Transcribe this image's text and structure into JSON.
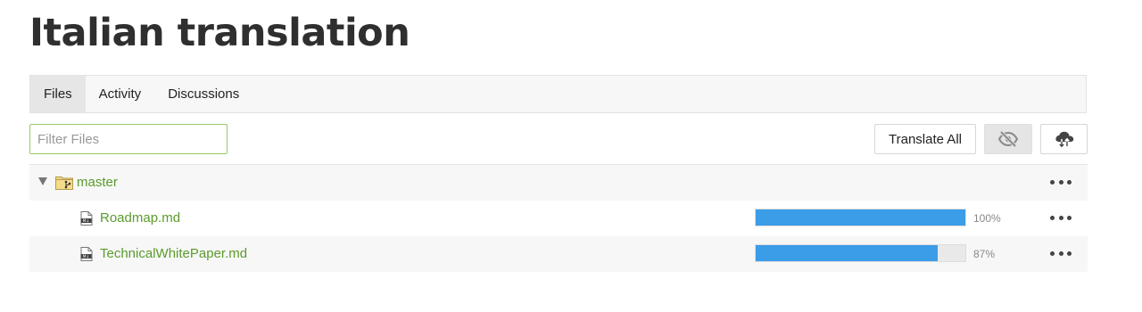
{
  "page": {
    "title": "Italian translation"
  },
  "tabs": [
    {
      "label": "Files",
      "active": true
    },
    {
      "label": "Activity",
      "active": false
    },
    {
      "label": "Discussions",
      "active": false
    }
  ],
  "toolbar": {
    "filter_placeholder": "Filter Files",
    "filter_value": "",
    "translate_all_label": "Translate All",
    "hide_icon": "eye-slash-icon",
    "sync_icon": "cloud-sync-icon"
  },
  "tree": {
    "branch": {
      "name": "master",
      "icon": "branch-folder-icon",
      "expanded": true
    },
    "files": [
      {
        "name": "Roadmap.md",
        "icon": "markdown-file-icon",
        "progress": 100,
        "progress_label": "100%"
      },
      {
        "name": "TechnicalWhitePaper.md",
        "icon": "markdown-file-icon",
        "progress": 87,
        "progress_label": "87%"
      }
    ]
  },
  "colors": {
    "accent_green": "#5b9a2c",
    "progress_blue": "#3b9ce8",
    "input_border": "#97c96a"
  }
}
